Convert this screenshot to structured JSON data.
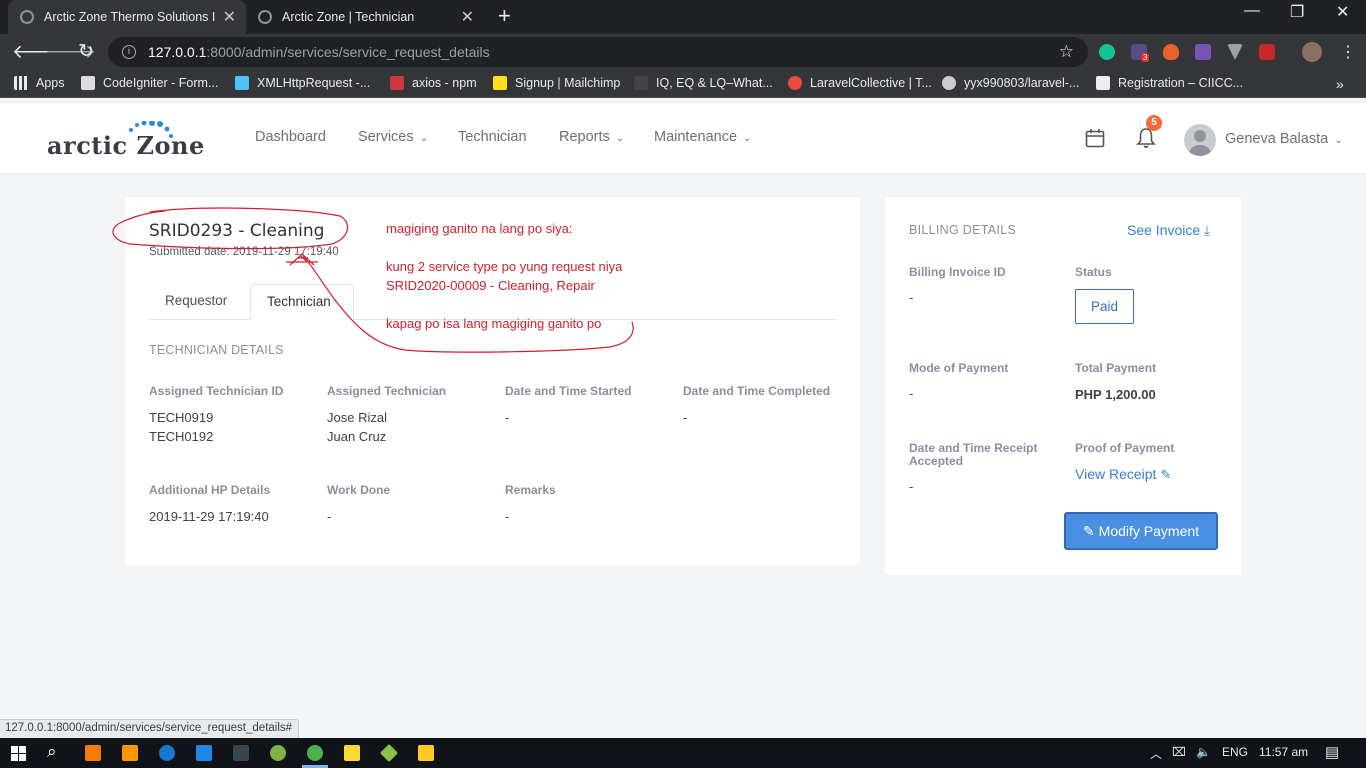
{
  "browser": {
    "tabs": [
      {
        "title": "Arctic Zone Thermo Solutions Inc",
        "active": true
      },
      {
        "title": "Arctic Zone | Technician",
        "active": false
      }
    ],
    "url_host": "127.0.0.1",
    "url_rest": ":8000/admin/services/service_request_details",
    "bookmarks": [
      "Apps",
      "CodeIgniter - Form...",
      "XMLHttpRequest -...",
      "axios - npm",
      "Signup | Mailchimp",
      "IQ, EQ & LQ–What...",
      "LaravelCollective | T...",
      "yyx990803/laravel-...",
      "Registration – CIICC..."
    ],
    "extension_badge": "3",
    "hover_url": "127.0.0.1:8000/admin/services/service_request_details#"
  },
  "header": {
    "logo_text": "arctic Zone",
    "nav": [
      {
        "label": "Dashboard",
        "dropdown": false
      },
      {
        "label": "Services",
        "dropdown": true
      },
      {
        "label": "Technician",
        "dropdown": false
      },
      {
        "label": "Reports",
        "dropdown": true
      },
      {
        "label": "Maintenance",
        "dropdown": true
      }
    ],
    "notification_count": "5",
    "user_name": "Geneva Balasta"
  },
  "request": {
    "title": "SRID0293 - Cleaning",
    "submitted": "Submitted date: 2019-11-29 17:19:40",
    "tabs": [
      "Requestor",
      "Technician"
    ],
    "active_tab": "Technician",
    "section_title": "TECHNICIAN DETAILS",
    "fields": {
      "assigned_technician_id": {
        "label": "Assigned Technician ID",
        "values": [
          "TECH0919",
          "TECH0192"
        ]
      },
      "assigned_technician": {
        "label": "Assigned Technician",
        "values": [
          "Jose Rizal",
          "Juan Cruz"
        ]
      },
      "date_started": {
        "label": "Date and Time Started",
        "value": "-"
      },
      "date_completed": {
        "label": "Date and Time Completed",
        "value": "-"
      },
      "additional_hp": {
        "label": "Additional HP Details",
        "value": "2019-11-29 17:19:40"
      },
      "work_done": {
        "label": "Work Done",
        "value": "-"
      },
      "remarks": {
        "label": "Remarks",
        "value": "-"
      }
    }
  },
  "billing": {
    "title": "BILLING DETAILS",
    "see_invoice": "See Invoice",
    "invoice_id": {
      "label": "Billing Invoice ID",
      "value": "-"
    },
    "status": {
      "label": "Status",
      "value": "Paid"
    },
    "mode_of_payment": {
      "label": "Mode of Payment",
      "value": "-"
    },
    "total_payment": {
      "label": "Total Payment",
      "value": "PHP 1,200.00"
    },
    "receipt_accepted": {
      "label_line1": "Date and Time Receipt",
      "label_line2": "Accepted",
      "value": "-"
    },
    "proof_of_payment": {
      "label": "Proof of Payment",
      "link": "View Receipt"
    },
    "modify_button": "Modify Payment"
  },
  "annotations": {
    "line1": "magiging ganito na lang po siya:",
    "line2": "kung 2 service type po yung request niya",
    "line3": "SRID2020-00009 - Cleaning, Repair",
    "line4": "kapag po isa lang magiging ganito po",
    "color": "#d11f2d"
  },
  "taskbar": {
    "language": "ENG",
    "time": "11:57 am"
  }
}
